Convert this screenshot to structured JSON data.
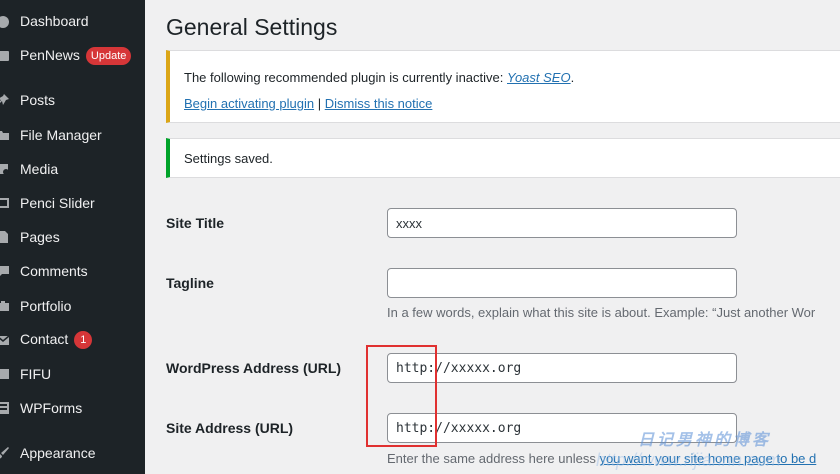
{
  "sidebar": {
    "items": [
      {
        "label": "Dashboard",
        "icon": "dashboard-icon"
      },
      {
        "label": "PenNews",
        "icon": "pennews-icon",
        "badge": "Update"
      },
      {
        "label": "Posts",
        "icon": "pin-icon"
      },
      {
        "label": "File Manager",
        "icon": "folder-icon"
      },
      {
        "label": "Media",
        "icon": "media-icon"
      },
      {
        "label": "Penci Slider",
        "icon": "slider-icon"
      },
      {
        "label": "Pages",
        "icon": "page-icon"
      },
      {
        "label": "Comments",
        "icon": "comment-icon"
      },
      {
        "label": "Portfolio",
        "icon": "portfolio-icon"
      },
      {
        "label": "Contact",
        "icon": "mail-icon",
        "badge": "1"
      },
      {
        "label": "FIFU",
        "icon": "fifu-icon"
      },
      {
        "label": "WPForms",
        "icon": "forms-icon"
      },
      {
        "label": "Appearance",
        "icon": "brush-icon"
      }
    ]
  },
  "page": {
    "title": "General Settings"
  },
  "notice_warning": {
    "text": "The following recommended plugin is currently inactive: ",
    "plugin": "Yoast SEO",
    "period": ".",
    "activate": "Begin activating plugin",
    "separator": "|",
    "dismiss": "Dismiss this notice"
  },
  "notice_success": {
    "text": "Settings saved."
  },
  "form": {
    "site_title": {
      "label": "Site Title",
      "value": "xxxx"
    },
    "tagline": {
      "label": "Tagline",
      "value": "",
      "description": "In a few words, explain what this site is about. Example: “Just another Wor"
    },
    "wp_address": {
      "label": "WordPress Address (URL)",
      "value": "http://xxxxx.org"
    },
    "site_address": {
      "label": "Site Address (URL)",
      "value": "http://xxxxx.org",
      "description_prefix": "Enter the same address here unless ",
      "description_link": "you want your site home page to be d"
    }
  },
  "watermark": {
    "text": "日记男神的博客",
    "url": "http://www.rijiannn.com"
  },
  "colors": {
    "sidebar_bg": "#1d2327",
    "link": "#2271b1",
    "warning": "#dba617",
    "success": "#00a32a",
    "badge": "#d63638",
    "highlight": "#e03030"
  }
}
